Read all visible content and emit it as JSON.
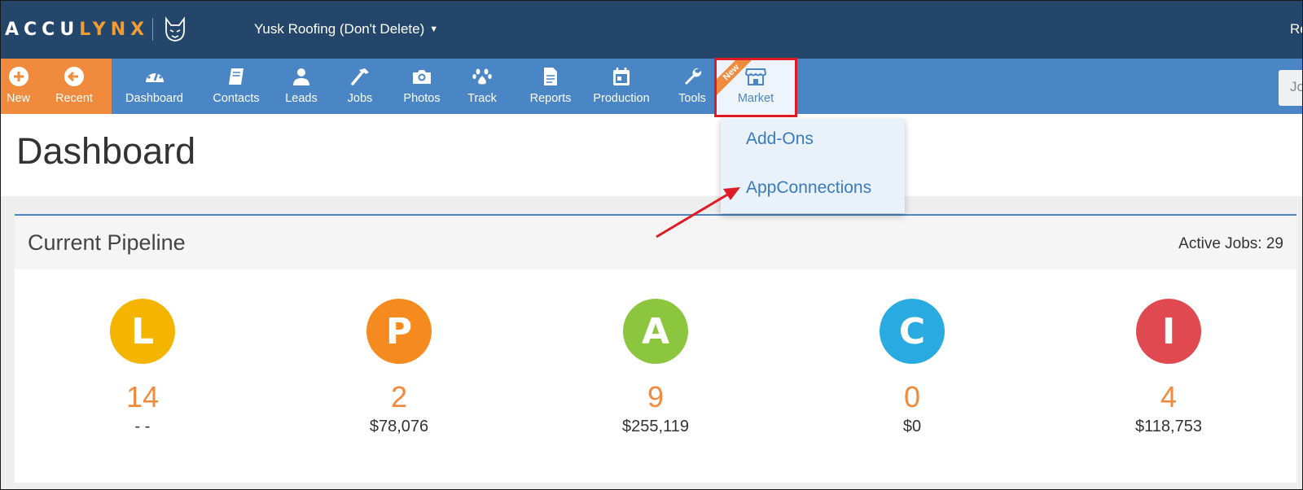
{
  "header": {
    "logo_part1": "ACCU",
    "logo_part2": "LYNX",
    "company": "Yusk Roofing (Don't Delete)",
    "right_text": "Re"
  },
  "nav": {
    "items": [
      {
        "label": "New",
        "icon": "plus-circle-icon"
      },
      {
        "label": "Recent",
        "icon": "arrow-left-circle-icon"
      },
      {
        "label": "Dashboard",
        "icon": "dashboard-gauge-icon"
      },
      {
        "label": "Contacts",
        "icon": "book-icon"
      },
      {
        "label": "Leads",
        "icon": "person-icon"
      },
      {
        "label": "Jobs",
        "icon": "hammer-icon"
      },
      {
        "label": "Photos",
        "icon": "camera-icon"
      },
      {
        "label": "Track",
        "icon": "paw-icon"
      },
      {
        "label": "Reports",
        "icon": "document-icon"
      },
      {
        "label": "Production",
        "icon": "calendar-icon"
      },
      {
        "label": "Tools",
        "icon": "wrench-icon"
      },
      {
        "label": "Market",
        "icon": "store-icon"
      }
    ],
    "new_badge": "New",
    "search_stub": "Jo"
  },
  "market_menu": {
    "items": [
      "Add-Ons",
      "AppConnections"
    ]
  },
  "page": {
    "title": "Dashboard"
  },
  "pipeline": {
    "title": "Current Pipeline",
    "active_jobs": "Active Jobs: 29",
    "stages": [
      {
        "letter": "L",
        "color": "#f4b400",
        "count": "14",
        "amount": "- -"
      },
      {
        "letter": "P",
        "color": "#f58a1f",
        "count": "2",
        "amount": "$78,076"
      },
      {
        "letter": "A",
        "color": "#8cc63f",
        "count": "9",
        "amount": "$255,119"
      },
      {
        "letter": "C",
        "color": "#29abe2",
        "count": "0",
        "amount": "$0"
      },
      {
        "letter": "I",
        "color": "#e0494f",
        "count": "4",
        "amount": "$118,753"
      }
    ]
  },
  "colors": {
    "header_bg": "#24466b",
    "nav_bg": "#4a86c5",
    "accent_orange": "#f08a3c",
    "highlight_red": "#e01b24"
  }
}
